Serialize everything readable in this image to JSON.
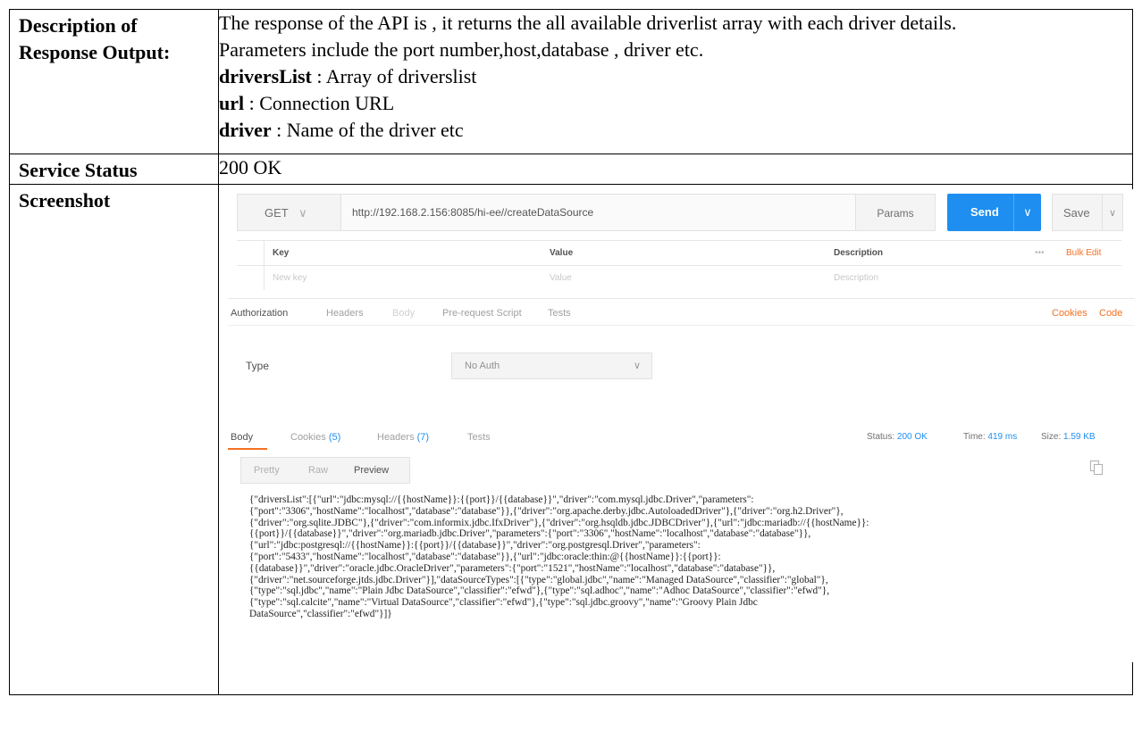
{
  "rows": {
    "description": {
      "label": "Description of Response Output:",
      "intro": "The response of the API is , it returns the all available driverlist array with each driver details.",
      "params": "Parameters include the port number,host,database , driver etc.",
      "fields": [
        {
          "name": "driversList",
          "desc": " : Array of driverslist"
        },
        {
          "name": "url",
          "desc": " : Connection URL"
        },
        {
          "name": "driver",
          "desc": " : Name of the driver etc"
        }
      ]
    },
    "status": {
      "label": "Service Status",
      "value": "200 OK"
    },
    "screenshot": {
      "label": "Screenshot"
    }
  },
  "postman": {
    "method": "GET",
    "url": "http://192.168.2.156:8085/hi-ee//createDataSource",
    "params_label": "Params",
    "send_label": "Send",
    "save_label": "Save",
    "kv_headers": {
      "key": "Key",
      "value": "Value",
      "description": "Description",
      "bulk_edit": "Bulk Edit",
      "more": "•••"
    },
    "kv_placeholders": {
      "key": "New key",
      "value": "Value",
      "description": "Description"
    },
    "request_tabs": [
      "Authorization",
      "Headers",
      "Body",
      "Pre-request Script",
      "Tests"
    ],
    "cookies_link": "Cookies",
    "code_link": "Code",
    "auth_type_label": "Type",
    "auth_type_value": "No Auth",
    "response_tabs": {
      "body": "Body",
      "cookies": "Cookies",
      "cookies_count": "(5)",
      "headers": "Headers",
      "headers_count": "(7)",
      "tests": "Tests"
    },
    "status_label": "Status:",
    "status_value": "200 OK",
    "time_label": "Time:",
    "time_value": "419 ms",
    "size_label": "Size:",
    "size_value": "1.59 KB",
    "view_modes": [
      "Pretty",
      "Raw",
      "Preview"
    ],
    "response_body": "{\"driversList\":[{\"url\":\"jdbc:mysql://{{hostName}}:{{port}}/{{database}}\",\"driver\":\"com.mysql.jdbc.Driver\",\"parameters\":\n{\"port\":\"3306\",\"hostName\":\"localhost\",\"database\":\"database\"}},{\"driver\":\"org.apache.derby.jdbc.AutoloadedDriver\"},{\"driver\":\"org.h2.Driver\"},\n{\"driver\":\"org.sqlite.JDBC\"},{\"driver\":\"com.informix.jdbc.IfxDriver\"},{\"driver\":\"org.hsqldb.jdbc.JDBCDriver\"},{\"url\":\"jdbc:mariadb://{{hostName}}:\n{{port}}/{{database}}\",\"driver\":\"org.mariadb.jdbc.Driver\",\"parameters\":{\"port\":\"3306\",\"hostName\":\"localhost\",\"database\":\"database\"}},\n{\"url\":\"jdbc:postgresql://{{hostName}}:{{port}}/{{database}}\",\"driver\":\"org.postgresql.Driver\",\"parameters\":\n{\"port\":\"5433\",\"hostName\":\"localhost\",\"database\":\"database\"}},{\"url\":\"jdbc:oracle:thin:@{{hostName}}:{{port}}:\n{{database}}\",\"driver\":\"oracle.jdbc.OracleDriver\",\"parameters\":{\"port\":\"1521\",\"hostName\":\"localhost\",\"database\":\"database\"}},\n{\"driver\":\"net.sourceforge.jtds.jdbc.Driver\"}],\"dataSourceTypes\":[{\"type\":\"global.jdbc\",\"name\":\"Managed DataSource\",\"classifier\":\"global\"},\n{\"type\":\"sql.jdbc\",\"name\":\"Plain Jdbc DataSource\",\"classifier\":\"efwd\"},{\"type\":\"sql.adhoc\",\"name\":\"Adhoc DataSource\",\"classifier\":\"efwd\"},\n{\"type\":\"sql.calcite\",\"name\":\"Virtual DataSource\",\"classifier\":\"efwd\"},{\"type\":\"sql.jdbc.groovy\",\"name\":\"Groovy Plain Jdbc\nDataSource\",\"classifier\":\"efwd\"}]}",
    "colors": {
      "accent": "#f47023",
      "send": "#1e8ef0",
      "link_blue": "#1e8ef0"
    }
  }
}
